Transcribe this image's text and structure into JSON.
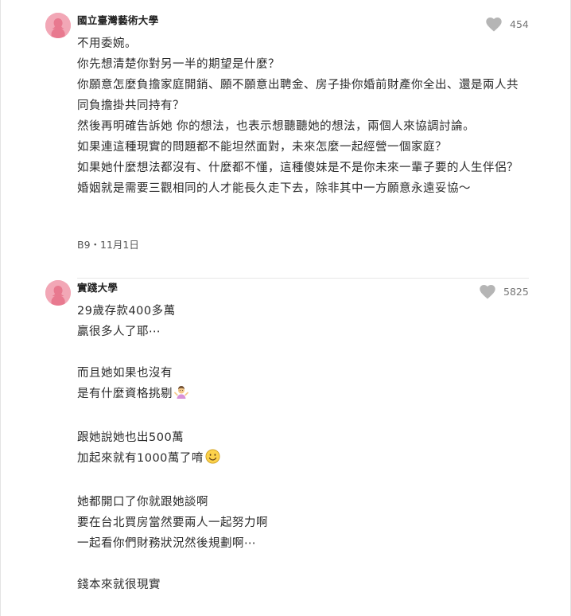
{
  "comments": [
    {
      "school": "國立臺灣藝術大學",
      "likes": "454",
      "lines": [
        "不用委婉。",
        "你先想清楚你對另一半的期望是什麼？",
        "你願意怎麼負擔家庭開銷、願不願意出聘金、房子掛你婚前財產你全出、還是兩人共同負擔掛共同持有？",
        "然後再明確告訴她 你的想法，也表示想聽聽她的想法，兩個人來協調討論。",
        "如果連這種現實的問題都不能坦然面對，未來怎麼一起經營一個家庭？",
        "如果她什麼想法都沒有、什麼都不懂，這種傻妹是不是你未來一輩子要的人生伴侶？",
        "婚姻就是需要三觀相同的人才能長久走下去，除非其中一方願意永遠妥協～"
      ],
      "meta": "B9・11月1日"
    },
    {
      "school": "實踐大學",
      "likes": "5825",
      "lines": [
        "29歲存款400多萬",
        "贏很多人了耶⋯",
        "",
        "而且她如果也沒有",
        "是有什麼資格挑剔",
        "",
        "跟她說她也出500萬",
        "加起來就有1000萬了唷",
        "",
        "她都開口了你就跟她談啊",
        "要在台北買房當然要兩人一起努力啊",
        "一起看你們財務狀況然後規劃啊⋯",
        "",
        "錢本來就很現實"
      ]
    }
  ],
  "icons": {
    "avatar": "female-avatar-icon",
    "like": "heart-icon",
    "emoji_shrug": "person-shrugging-emoji",
    "emoji_smile": "slightly-smiling-face-emoji"
  },
  "colors": {
    "avatar_bg": "#f2a7b6",
    "avatar_figure": "#e8798f",
    "heart": "#b5b5b5",
    "text": "#2b2b2b",
    "meta": "#555555"
  }
}
